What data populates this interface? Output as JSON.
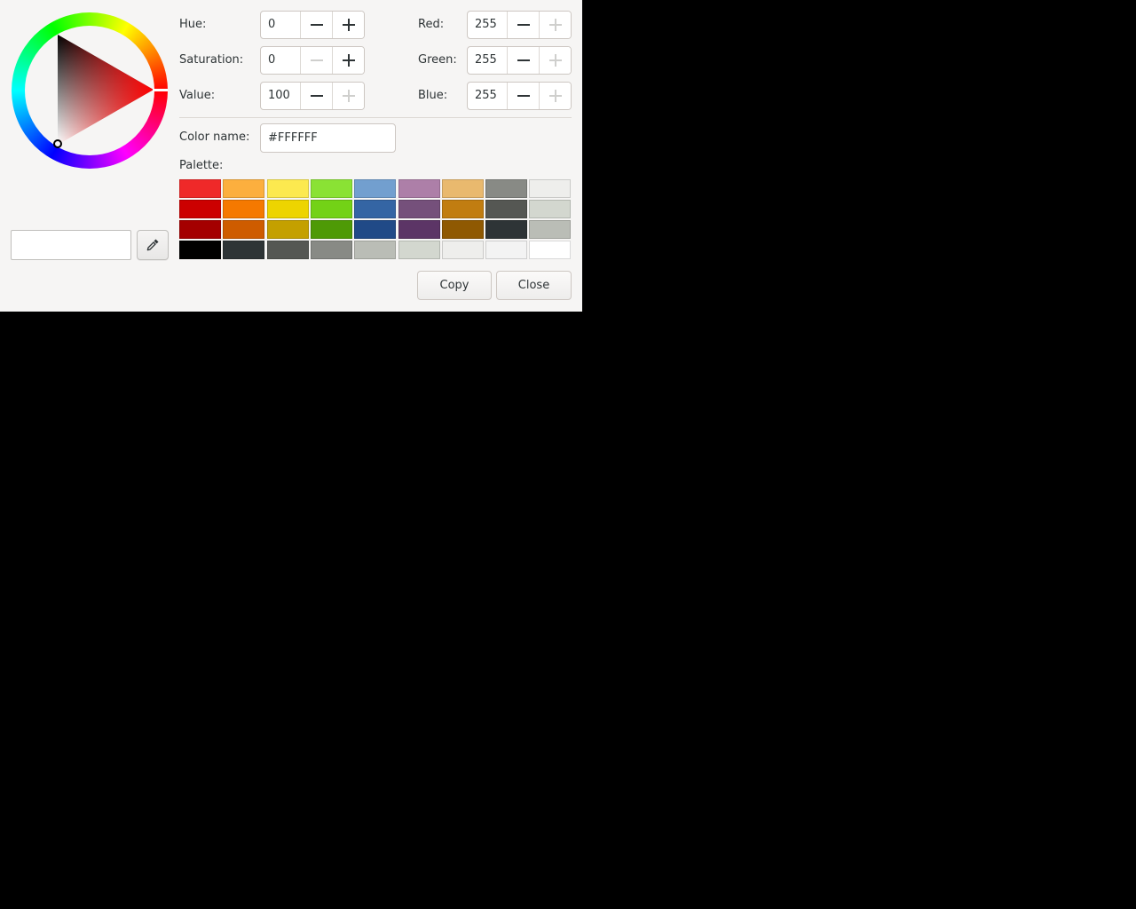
{
  "hsv": {
    "hue_label": "Hue:",
    "hue_value": "0",
    "saturation_label": "Saturation:",
    "saturation_value": "0",
    "value_label": "Value:",
    "value_value": "100"
  },
  "rgb": {
    "red_label": "Red:",
    "red_value": "255",
    "green_label": "Green:",
    "green_value": "255",
    "blue_label": "Blue:",
    "blue_value": "255"
  },
  "color_name": {
    "label": "Color name:",
    "value": "#FFFFFF"
  },
  "palette": {
    "label": "Palette:",
    "rows": [
      [
        "#ef2929",
        "#fcaf3e",
        "#fce94f",
        "#8ae234",
        "#729fcf",
        "#ad7fa8",
        "#e9b96e",
        "#888a85",
        "#eeeeec"
      ],
      [
        "#cc0000",
        "#f57900",
        "#edd400",
        "#73d216",
        "#3465a4",
        "#75507b",
        "#c17d11",
        "#555753",
        "#d3d7cf"
      ],
      [
        "#a40000",
        "#ce5c00",
        "#c4a000",
        "#4e9a06",
        "#204a87",
        "#5c3566",
        "#8f5902",
        "#2e3436",
        "#babdb6"
      ],
      [
        "#000000",
        "#2e3436",
        "#555753",
        "#888a85",
        "#babdb6",
        "#d3d7cf",
        "#eeeeec",
        "#f3f3f3",
        "#ffffff"
      ]
    ]
  },
  "current_color": "#ffffff",
  "icons": {
    "eyedropper": "eyedropper-icon",
    "minus": "minus-icon",
    "plus": "plus-icon"
  },
  "buttons": {
    "copy": "Copy",
    "close": "Close"
  }
}
